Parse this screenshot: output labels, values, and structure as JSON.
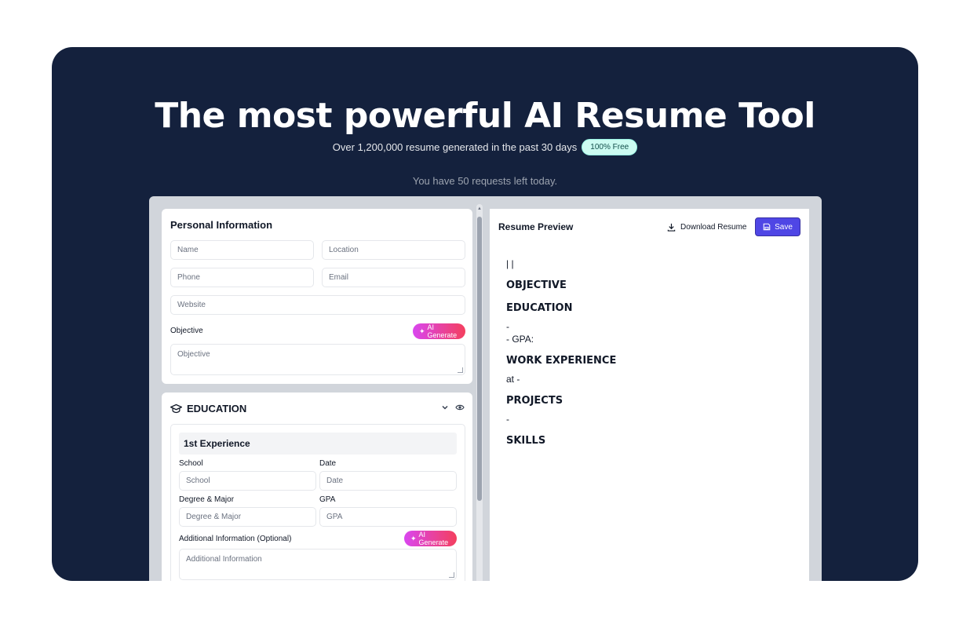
{
  "hero": {
    "title": "The most powerful AI Resume Tool",
    "subtitle": "Over 1,200,000 resume generated in the past 30 days",
    "badge": "100% Free",
    "requests": "You have 50 requests left today."
  },
  "personal": {
    "title": "Personal Information",
    "name_placeholder": "Name",
    "location_placeholder": "Location",
    "phone_placeholder": "Phone",
    "email_placeholder": "Email",
    "website_placeholder": "Website",
    "objective_label": "Objective",
    "objective_placeholder": "Objective",
    "ai_generate": "AI Generate"
  },
  "education": {
    "title": "EDUCATION",
    "entry_title": "1st Experience",
    "school_label": "School",
    "school_placeholder": "School",
    "date_label": "Date",
    "date_placeholder": "Date",
    "degree_label": "Degree & Major",
    "degree_placeholder": "Degree & Major",
    "gpa_label": "GPA",
    "gpa_placeholder": "GPA",
    "additional_label": "Additional Information (Optional)",
    "additional_placeholder": "Additional Information",
    "ai_generate": "AI Generate"
  },
  "preview": {
    "title": "Resume Preview",
    "download": "Download Resume",
    "save": "Save",
    "header_line": "| |",
    "objective": "OBJECTIVE",
    "education": "EDUCATION",
    "edu_line1": "-",
    "edu_line2": "- GPA:",
    "work": "WORK EXPERIENCE",
    "work_line": "at -",
    "projects": "PROJECTS",
    "projects_line": "-",
    "skills": "SKILLS"
  },
  "colors": {
    "hero_bg": "#14213d",
    "accent": "#4f46e5",
    "ai_gradient_start": "#d946ef",
    "ai_gradient_end": "#f43f5e"
  }
}
